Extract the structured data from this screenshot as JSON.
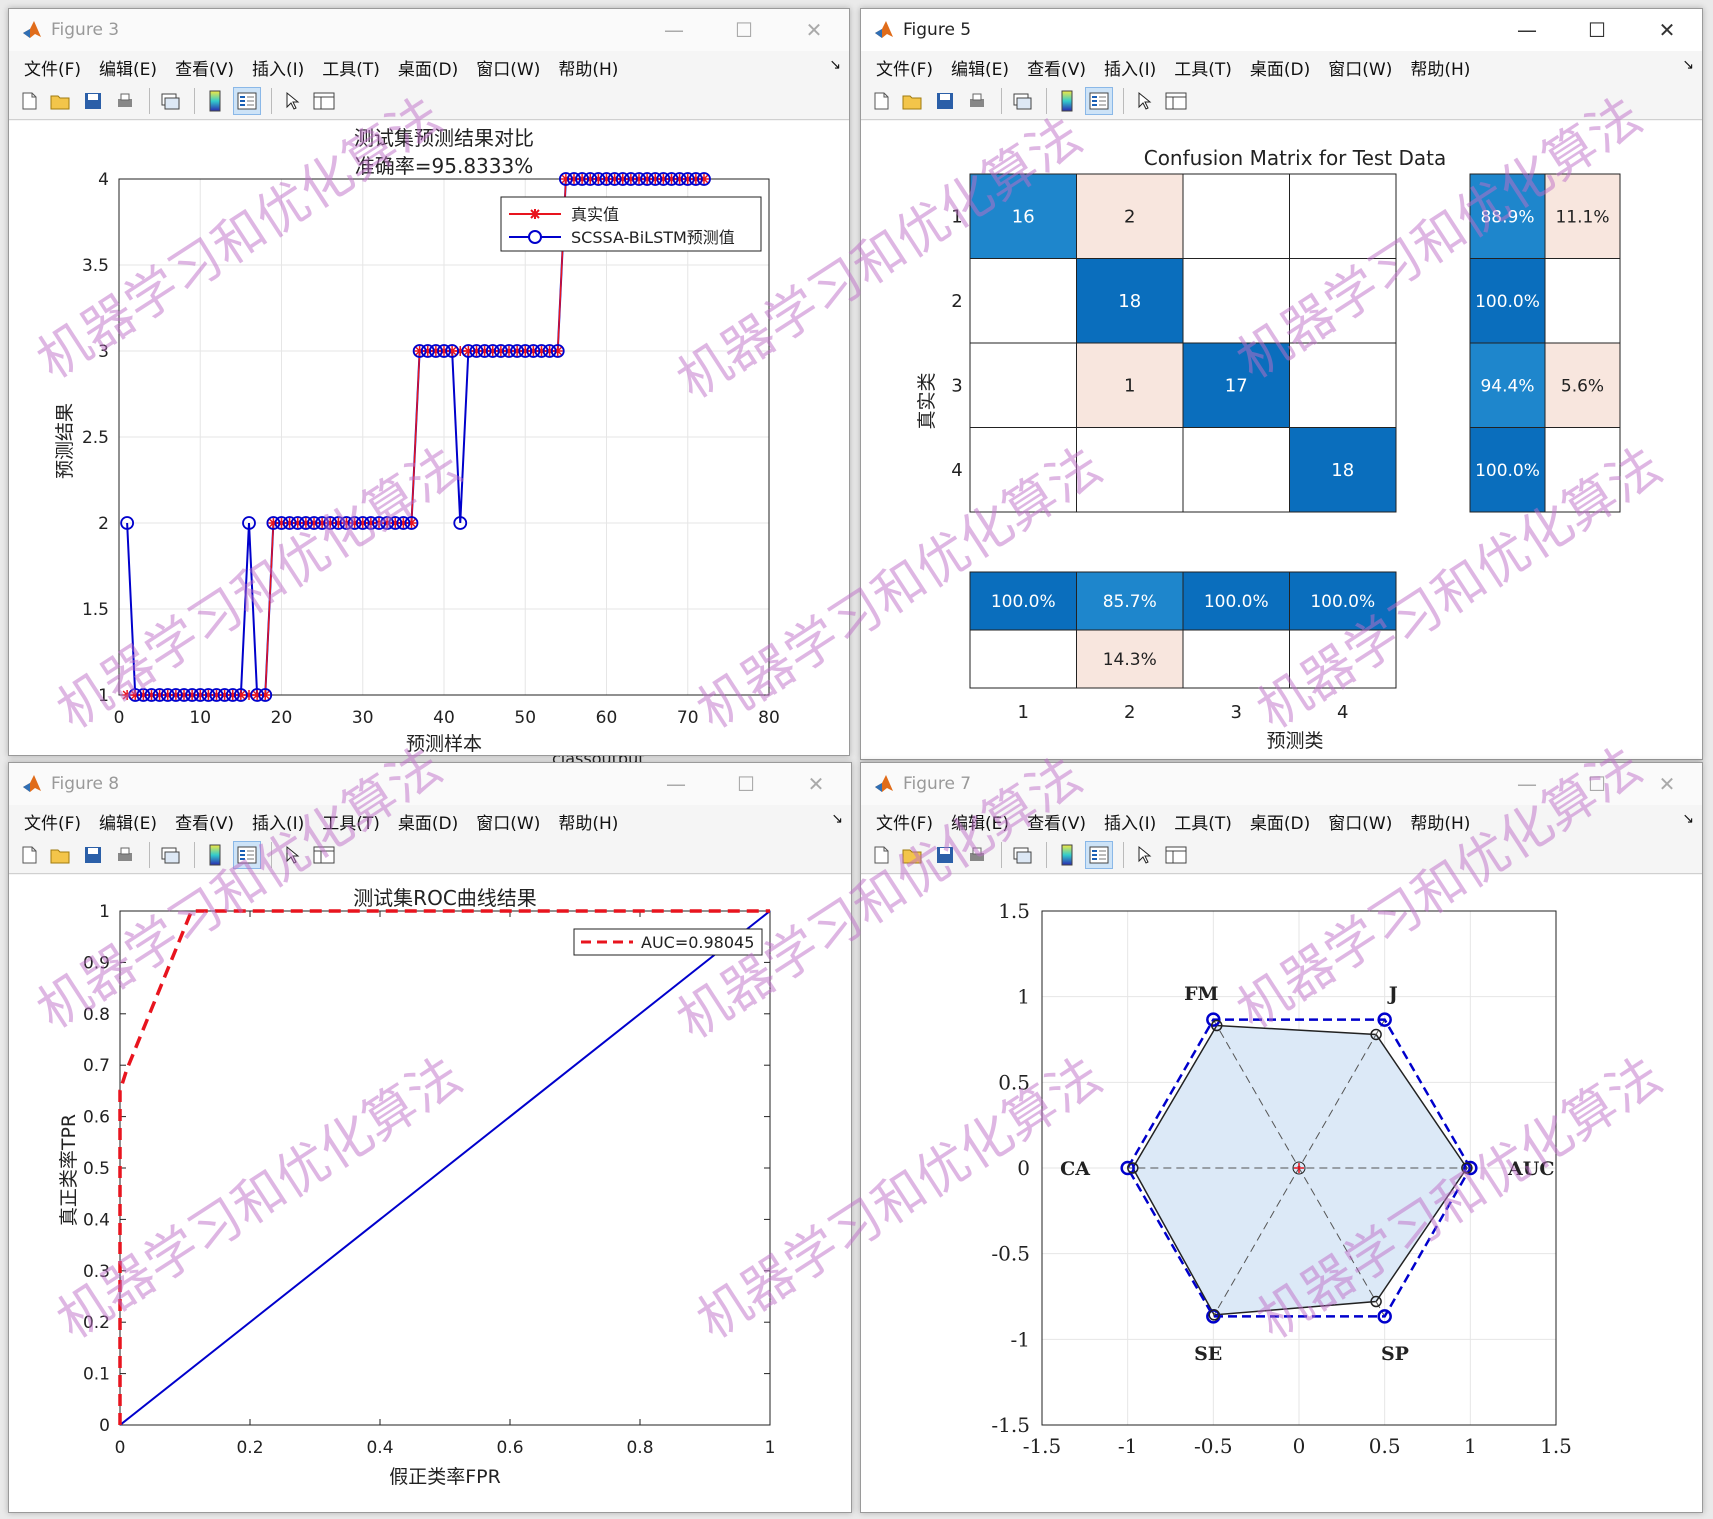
{
  "windows": {
    "fig3": {
      "title": "Figure 3"
    },
    "fig5": {
      "title": "Figure 5"
    },
    "fig8": {
      "title": "Figure 8"
    },
    "fig7": {
      "title": "Figure 7"
    }
  },
  "menu": [
    "文件(F)",
    "编辑(E)",
    "查看(V)",
    "插入(I)",
    "工具(T)",
    "桌面(D)",
    "窗口(W)",
    "帮助(H)"
  ],
  "background_text": "classoutput",
  "watermark": "机器学习和优化算法",
  "colors": {
    "red": "#e8141e",
    "blue": "#0000cc",
    "cm_dark": "#0a6ebd",
    "cm_mid": "#1e86cc",
    "cm_light": "#f8e6de",
    "radar_fill": "#dce9f7"
  },
  "chart_data": [
    {
      "type": "line",
      "title": "测试集预测结果对比",
      "subtitle": "准确率=95.8333%",
      "xlabel": "预测样本",
      "ylabel": "预测结果",
      "xlim": [
        0,
        80
      ],
      "ylim": [
        1,
        4
      ],
      "xticks": [
        "0",
        "10",
        "20",
        "30",
        "40",
        "50",
        "60",
        "70",
        "80"
      ],
      "yticks": [
        "1",
        "1.5",
        "2",
        "2.5",
        "3",
        "3.5",
        "4"
      ],
      "grid": true,
      "legend": "top-right",
      "series": [
        {
          "name": "真实值",
          "values": [
            1,
            1,
            1,
            1,
            1,
            1,
            1,
            1,
            1,
            1,
            1,
            1,
            1,
            1,
            1,
            1,
            1,
            1,
            2,
            2,
            2,
            2,
            2,
            2,
            2,
            2,
            2,
            2,
            2,
            2,
            2,
            2,
            2,
            2,
            2,
            2,
            3,
            3,
            3,
            3,
            3,
            3,
            3,
            3,
            3,
            3,
            3,
            3,
            3,
            3,
            3,
            3,
            3,
            3,
            4,
            4,
            4,
            4,
            4,
            4,
            4,
            4,
            4,
            4,
            4,
            4,
            4,
            4,
            4,
            4,
            4,
            4
          ]
        },
        {
          "name": "SCSSA-BiLSTM预测值",
          "values": [
            2,
            1,
            1,
            1,
            1,
            1,
            1,
            1,
            1,
            1,
            1,
            1,
            1,
            1,
            1,
            2,
            1,
            1,
            2,
            2,
            2,
            2,
            2,
            2,
            2,
            2,
            2,
            2,
            2,
            2,
            2,
            2,
            2,
            2,
            2,
            2,
            3,
            3,
            3,
            3,
            3,
            2,
            3,
            3,
            3,
            3,
            3,
            3,
            3,
            3,
            3,
            3,
            3,
            3,
            4,
            4,
            4,
            4,
            4,
            4,
            4,
            4,
            4,
            4,
            4,
            4,
            4,
            4,
            4,
            4,
            4,
            4
          ]
        }
      ]
    },
    {
      "type": "heatmap",
      "title": "Confusion Matrix for Test Data",
      "xlabel": "预测类",
      "ylabel": "真实类",
      "classes": [
        "1",
        "2",
        "3",
        "4"
      ],
      "matrix": [
        [
          16,
          2,
          null,
          null
        ],
        [
          null,
          18,
          null,
          null
        ],
        [
          null,
          1,
          17,
          null
        ],
        [
          null,
          null,
          null,
          18
        ]
      ],
      "row_summary": [
        [
          "88.9%",
          "11.1%"
        ],
        [
          "100.0%",
          ""
        ],
        [
          "94.4%",
          "5.6%"
        ],
        [
          "100.0%",
          ""
        ]
      ],
      "col_summary": [
        [
          "100.0%",
          "85.7%",
          "100.0%",
          "100.0%"
        ],
        [
          "",
          "14.3%",
          "",
          ""
        ]
      ]
    },
    {
      "type": "line",
      "title": "测试集ROC曲线结果",
      "xlabel": "假正类率FPR",
      "ylabel": "真正类率TPR",
      "xlim": [
        0,
        1
      ],
      "ylim": [
        0,
        1
      ],
      "xticks": [
        "0",
        "0.2",
        "0.4",
        "0.6",
        "0.8",
        "1"
      ],
      "yticks": [
        "0",
        "0.1",
        "0.2",
        "0.3",
        "0.4",
        "0.5",
        "0.6",
        "0.7",
        "0.8",
        "0.9",
        "1"
      ],
      "legend": "top-right",
      "series": [
        {
          "name": "AUC=0.98045",
          "x": [
            0,
            0,
            0.01,
            0.11,
            1
          ],
          "y": [
            0,
            0.65,
            0.69,
            1,
            1
          ]
        },
        {
          "x": [
            0,
            1
          ],
          "y": [
            0,
            1
          ]
        }
      ]
    },
    {
      "type": "scatter",
      "subtype": "radar",
      "xlim": [
        -1.5,
        1.5
      ],
      "ylim": [
        -1.5,
        1.5
      ],
      "xticks": [
        "-1.5",
        "-1",
        "-0.5",
        "0",
        "0.5",
        "1",
        "1.5"
      ],
      "yticks": [
        "-1.5",
        "-1",
        "-0.5",
        "0",
        "0.5",
        "1",
        "1.5"
      ],
      "grid": true,
      "axes_labels": [
        "AUC",
        "J",
        "FM",
        "CA",
        "SE",
        "SP"
      ],
      "values": [
        0.98,
        0.9,
        0.96,
        0.97,
        0.99,
        0.9
      ]
    }
  ]
}
